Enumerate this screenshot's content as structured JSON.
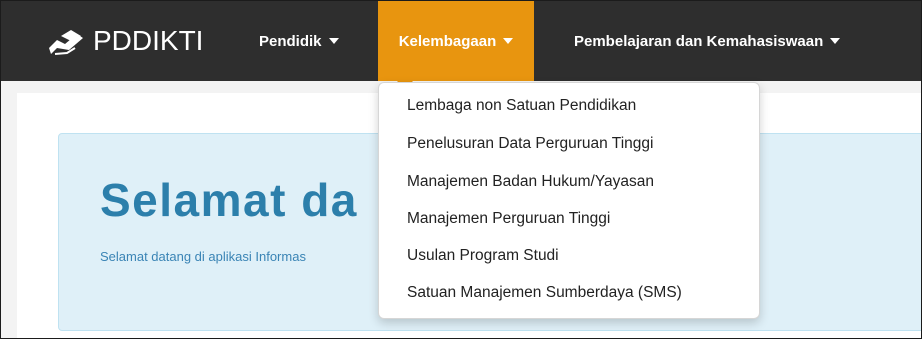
{
  "brand": {
    "name": "PDDIKTI"
  },
  "navbar": {
    "items": [
      {
        "label": "Pendidik",
        "active": false
      },
      {
        "label": "Kelembagaan",
        "active": true
      },
      {
        "label": "Pembelajaran dan Kemahasiswaan",
        "active": false
      }
    ]
  },
  "dropdown": {
    "items": [
      "Lembaga non Satuan Pendidikan",
      "Penelusuran Data Perguruan Tinggi",
      "Manajemen Badan Hukum/Yayasan",
      "Manajemen Perguruan Tinggi",
      "Usulan Program Studi",
      "Satuan Manajemen Sumberdaya (SMS)"
    ]
  },
  "hero": {
    "title": "Selamat da",
    "subtitle": "Selamat datang di aplikasi Informas"
  },
  "colors": {
    "navbar": "#2e2e2e",
    "active_tab": "#e8950f",
    "jumbotron": "#dff0f8",
    "title": "#2c7fab"
  }
}
